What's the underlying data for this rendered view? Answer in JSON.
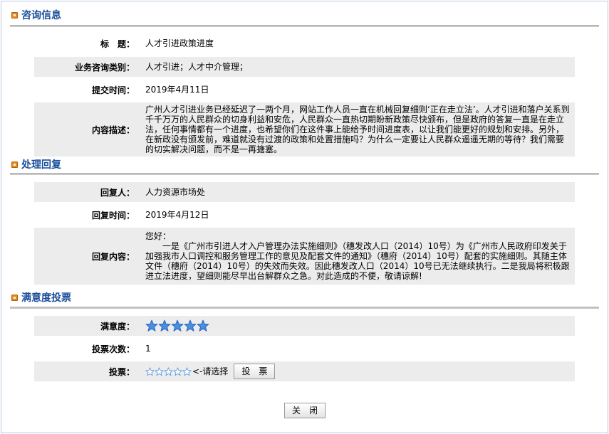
{
  "consult": {
    "section_title": "咨询信息",
    "rows": [
      {
        "label": "标　题：",
        "value": "人才引进政策进度"
      },
      {
        "label": "业务咨询类别：",
        "value": "人才引进；人才中介管理；"
      },
      {
        "label": "提交时间：",
        "value": "2019年4月11日"
      },
      {
        "label": "内容描述：",
        "value": "广州人才引进业务已经延迟了一两个月，网站工作人员一直在机械回复细则‘正在走立法’。人才引进和落户关系到千千万万的人民群众的切身利益和安危，人民群众一直热切期盼新政策尽快颁布，但是政府的答复一直是在走立法，任何事情都有一个进度，也希望你们在这件事上能给予时间进度表，以让我们能更好的规划和安排。另外，在新政没有颁发前，难道就没有过渡的政策和处置措施吗？为什么一定要让人民群众遥遥无期的等待？我们需要的切实解决问题，而不是一再搪塞。"
      }
    ]
  },
  "reply": {
    "section_title": "处理回复",
    "rows": [
      {
        "label": "回复人：",
        "value": "人力资源市场处"
      },
      {
        "label": "回复时间：",
        "value": "2019年4月12日"
      },
      {
        "label": "回复内容：",
        "greeting": "您好：",
        "value": "一是《广州市引进人才入户管理办法实施细则》（穗发改人口（2014）10号）为《广州市人民政府印发关于加强我市人口调控和服务管理工作的意见及配套文件的通知》（穗府（2014）10号）配套的实施细则。其随主体文件（穗府（2014）10号）的失效而失效。因此穗发改人口（2014）10号已无法继续执行。二是我局将积极跟进立法进度，望细则能尽早出台解群众之急。对此造成的不便，敬请谅解!"
      }
    ]
  },
  "vote": {
    "section_title": "满意度投票",
    "satisfaction_label": "满意度：",
    "satisfaction_stars": 5,
    "satisfaction_max": 5,
    "count_label": "投票次数：",
    "count_value": "1",
    "vote_label": "投票：",
    "vote_hint": "<-请选择",
    "vote_button": "投　票"
  },
  "close_button": "关　闭",
  "colors": {
    "title": "#1a4d9a",
    "row_shade": "#ececec",
    "star_fill": "#4a8ee0",
    "star_outline": "#2a6ac0"
  }
}
